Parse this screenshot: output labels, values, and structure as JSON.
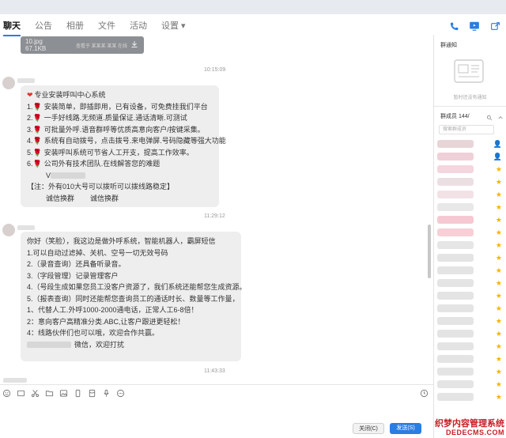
{
  "tabs": [
    "聊天",
    "公告",
    "相册",
    "文件",
    "活动",
    "设置 ▾"
  ],
  "file_card": {
    "name": "10.jpg",
    "size": "67.1KB",
    "desc": "查看于 某某某 某某 在线"
  },
  "messages": [
    {
      "timestamp": "10:15:09",
      "lines": [
        "专业安装呼叫中心系统",
        "安装简单，即插即用，已有设备，可免费挂我们平台",
        "一手好线路.无频道.质量保证.通话清晰.可测试",
        "可批量外呼.语音群呼等优质高意向客户/按键采集。",
        "系统有自动拨号，点击拨号.来电弹屏.号码隐藏等强大功能",
        "安装呼叫系统可节省人工开支，提高工作效率。",
        "公司外有技术团队.在线解答您的难题",
        "V",
        "【注：外有010大号可以拨听可以拨线路稳定】",
        "诚信换群        诚信换群"
      ]
    },
    {
      "timestamp": "11:29:12",
      "lines": [
        "你好（笑脸），我这边是做外呼系统，智能机器人，霸屏短信",
        "1.可以自动过滤掉、关机、空号一切无效号码",
        "2.（录音查询）还具备听录音。",
        "3.（字段管理）记录管理客户",
        "4.（号段生成如果您员工没客户资源了，我们系统还能帮您生成资源。",
        "5.（报表查询）同时还能帮您查询员工的通话时长、数量等工作量，",
        "1、代替人工.外呼1000-2000通电话，正常人工6-8倍！",
        "2：意向客户高精准分类.ABC,让客户跟进更轻松！",
        "4：线路伙伴们也可以哦，欢迎合作共赢。",
        "微信，欢迎打扰"
      ]
    }
  ],
  "last_timestamp": "11:43:33",
  "buttons": {
    "close": "关闭(C)",
    "send": "发送(S)"
  },
  "right_panel": {
    "announcement_title": "群通知",
    "announcement_empty": "暂时还没有通知",
    "members_title": "群成员 144/",
    "member_search_placeholder": "搜索群成员"
  },
  "watermark": {
    "line1": "织梦内容管理系统",
    "line2": "DEDECMS.COM"
  },
  "icons": {
    "phone": "phone-icon",
    "video": "video-icon",
    "share": "share-icon",
    "download": "download-icon",
    "history": "history-icon"
  },
  "colors": {
    "accent": "#2a7de1",
    "badge_green": "#3fae49",
    "badge_star": "#f4b400",
    "watermark": "#c81d25"
  }
}
